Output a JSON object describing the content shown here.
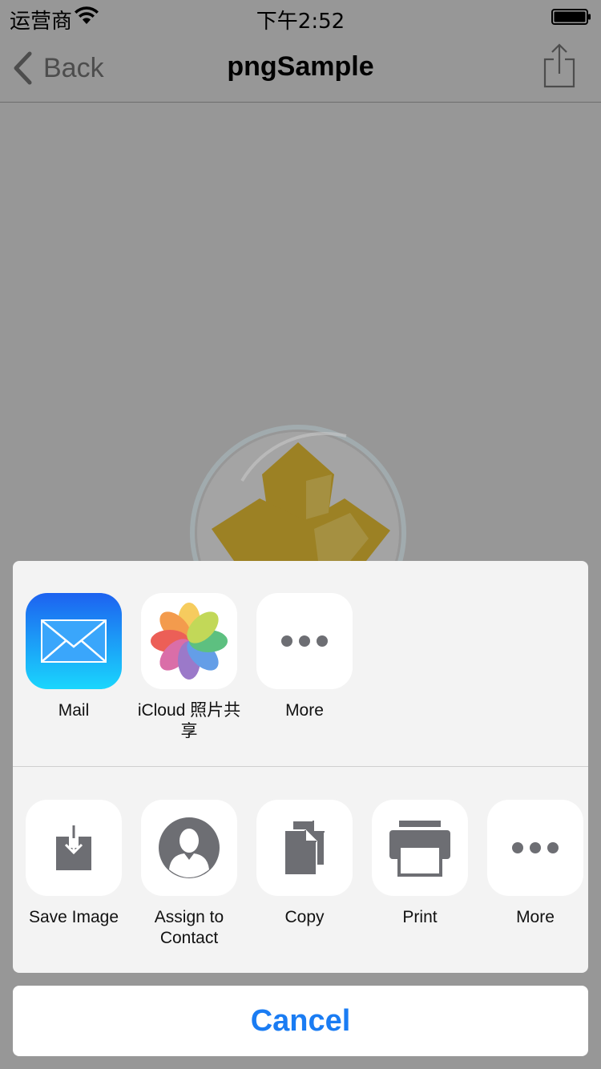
{
  "status_bar": {
    "carrier": "运营商",
    "time": "下午2:52"
  },
  "nav": {
    "back_label": "Back",
    "title": "pngSample"
  },
  "share_sheet": {
    "apps": [
      {
        "label": "Mail",
        "icon": "mail-icon"
      },
      {
        "label": "iCloud 照片共享",
        "icon": "photos-icon"
      },
      {
        "label": "More",
        "icon": "more-icon"
      }
    ],
    "actions": [
      {
        "label": "Save Image",
        "icon": "save-image-icon"
      },
      {
        "label": "Assign to Contact",
        "icon": "contact-icon"
      },
      {
        "label": "Copy",
        "icon": "copy-icon"
      },
      {
        "label": "Print",
        "icon": "print-icon"
      },
      {
        "label": "More",
        "icon": "more-icon"
      }
    ],
    "cancel_label": "Cancel"
  },
  "colors": {
    "accent": "#1a7cf3",
    "overlay": "#979797",
    "sheet_bg": "#f3f3f3",
    "action_glyph": "#6d6e73"
  }
}
